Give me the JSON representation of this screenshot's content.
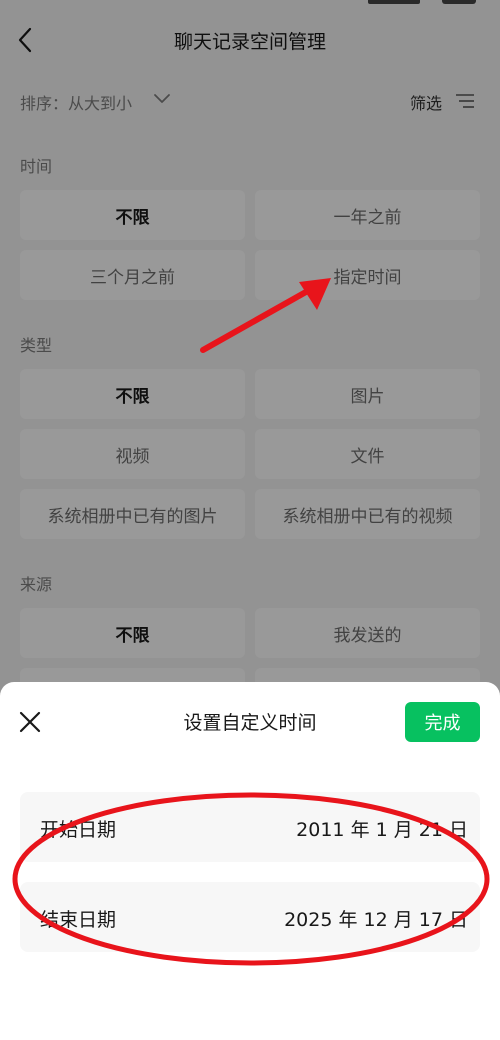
{
  "nav": {
    "title": "聊天记录空间管理"
  },
  "sort": {
    "label": "排序：从大到小",
    "filter_label": "筛选"
  },
  "sections": {
    "time": {
      "title": "时间",
      "options": [
        "不限",
        "一年之前",
        "三个月之前",
        "指定时间"
      ],
      "selected": "不限"
    },
    "type": {
      "title": "类型",
      "options": [
        "不限",
        "图片",
        "视频",
        "文件",
        "系统相册中已有的图片",
        "系统相册中已有的视频"
      ],
      "selected": "不限"
    },
    "source": {
      "title": "来源",
      "options": [
        "不限",
        "我发送的"
      ],
      "selected": "不限"
    }
  },
  "sheet": {
    "title": "设置自定义时间",
    "done_label": "完成",
    "start": {
      "label": "开始日期",
      "value": "2011 年 1 月 21 日"
    },
    "end": {
      "label": "结束日期",
      "value": "2025 年 12 月 17 日"
    }
  },
  "colors": {
    "accent_green": "#07c160",
    "annotation_red": "#e8141b"
  },
  "icons": {
    "back": "chevron-left-icon",
    "sort_dropdown": "chevron-down-icon",
    "filter": "filter-lines-icon",
    "close": "close-icon"
  }
}
